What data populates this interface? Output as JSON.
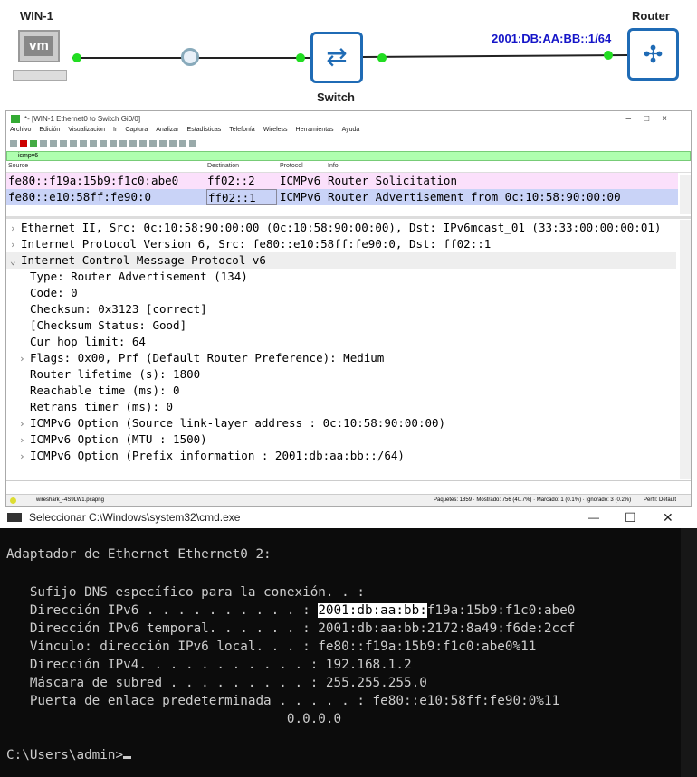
{
  "topology": {
    "win_label": "WIN-1",
    "switch_label": "Switch",
    "router_label": "Router",
    "router_ip": "2001:DB:AA:BB::1/64",
    "vm_text": "vm",
    "link_color": "#22dd22",
    "device_color": "#1f6bb5"
  },
  "wireshark": {
    "title": "*- [WIN-1 Ethernet0 to Switch Gi0/0]",
    "window_controls": [
      "–",
      "□",
      "×"
    ],
    "menu": [
      "Archivo",
      "Edición",
      "Visualización",
      "Ir",
      "Captura",
      "Analizar",
      "Estadísticas",
      "Telefonía",
      "Wireless",
      "Herramientas",
      "Ayuda"
    ],
    "filter": "icmpv6",
    "columns": [
      "Source",
      "Destination",
      "Protocol",
      "Info"
    ],
    "packets": [
      {
        "source": "fe80::f19a:15b9:f1c0:abe0",
        "destination": "ff02::2",
        "protocol": "ICMPv6",
        "info": "Router Solicitation",
        "color": "#fbe0fb"
      },
      {
        "source": "fe80::e10:58ff:fe90:0",
        "destination": "ff02::1",
        "protocol": "ICMPv6",
        "info": "Router Advertisement from 0c:10:58:90:00:00",
        "color": "#c9d3f7"
      }
    ],
    "details": [
      {
        "text": "Ethernet II, Src: 0c:10:58:90:00:00 (0c:10:58:90:00:00), Dst: IPv6mcast_01 (33:33:00:00:00:01)",
        "level": 0,
        "arrow": "›"
      },
      {
        "text": "Internet Protocol Version 6, Src: fe80::e10:58ff:fe90:0, Dst: ff02::1",
        "level": 0,
        "arrow": "›"
      },
      {
        "text": "Internet Control Message Protocol v6",
        "level": 0,
        "arrow": "⌄"
      },
      {
        "text": "Type: Router Advertisement (134)",
        "level": 1,
        "arrow": ""
      },
      {
        "text": "Code: 0",
        "level": 1,
        "arrow": ""
      },
      {
        "text": "Checksum: 0x3123 [correct]",
        "level": 1,
        "arrow": ""
      },
      {
        "text": "[Checksum Status: Good]",
        "level": 1,
        "arrow": ""
      },
      {
        "text": "Cur hop limit: 64",
        "level": 1,
        "arrow": ""
      },
      {
        "text": "Flags: 0x00, Prf (Default Router Preference): Medium",
        "level": 1,
        "arrow": "›"
      },
      {
        "text": "Router lifetime (s): 1800",
        "level": 1,
        "arrow": ""
      },
      {
        "text": "Reachable time (ms): 0",
        "level": 1,
        "arrow": ""
      },
      {
        "text": "Retrans timer (ms): 0",
        "level": 1,
        "arrow": ""
      },
      {
        "text": "ICMPv6 Option (Source link-layer address : 0c:10:58:90:00:00)",
        "level": 1,
        "arrow": "›"
      },
      {
        "text": "ICMPv6 Option (MTU : 1500)",
        "level": 1,
        "arrow": "›"
      },
      {
        "text": "ICMPv6 Option (Prefix information : 2001:db:aa:bb::/64)",
        "level": 1,
        "arrow": "›"
      }
    ],
    "status_file": "wireshark_-4S9LW1.pcapng",
    "status_stats": "Paquetes: 1859 · Mostrado: 756 (40.7%) · Marcado: 1 (0.1%) · Ignorado: 3 (0.2%)",
    "status_profile": "Perfil: Default"
  },
  "cmd": {
    "title": "Seleccionar C:\\Windows\\system32\\cmd.exe",
    "window_controls": [
      "—",
      "☐",
      "✕"
    ],
    "adapter": "Adaptador de Ethernet Ethernet0 2:",
    "lines": [
      "   Sufijo DNS específico para la conexión. . :",
      "   Dirección IPv6 . . . . . . . . . . : ",
      "   Dirección IPv6 temporal. . . . . . : 2001:db:aa:bb:2172:8a49:f6de:2ccf",
      "   Vínculo: dirección IPv6 local. . . : fe80::f19a:15b9:f1c0:abe0%11",
      "   Dirección IPv4. . . . . . . . . . . : 192.168.1.2",
      "   Máscara de subred . . . . . . . . . : 255.255.255.0",
      "   Puerta de enlace predeterminada . . . . . : fe80::e10:58ff:fe90:0%11",
      "                                    0.0.0.0"
    ],
    "ipv6_highlight": "2001:db:aa:bb:",
    "ipv6_rest": "f19a:15b9:f1c0:abe0",
    "prompt": "C:\\Users\\admin>"
  }
}
